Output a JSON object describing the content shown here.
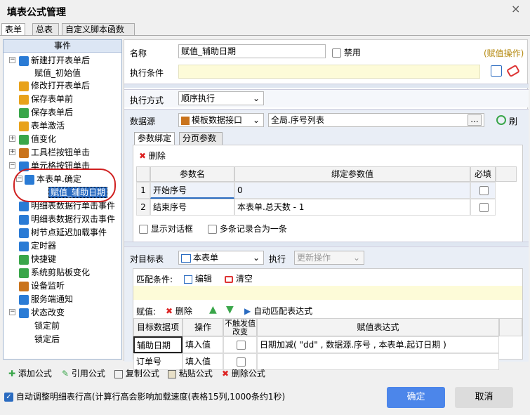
{
  "window": {
    "title": "填表公式管理",
    "close": "×"
  },
  "tabs": [
    "表单",
    "总表",
    "自定义脚本函数"
  ],
  "left": {
    "header": "事件",
    "items": [
      {
        "label": "新建打开表单后",
        "icon": "person-icon",
        "color": "#2a7bd5"
      },
      {
        "label": "赋值_初始值",
        "icon": "",
        "color": ""
      },
      {
        "label": "修改打开表单后",
        "icon": "folder-icon",
        "color": "#e8a21b"
      },
      {
        "label": "保存表单前",
        "icon": "folder-icon",
        "color": "#e8a21b"
      },
      {
        "label": "保存表单后",
        "icon": "folder-icon",
        "color": "#3aa64a"
      },
      {
        "label": "表单激活",
        "icon": "folder-icon",
        "color": "#e8a21b"
      },
      {
        "label": "值变化",
        "icon": "123-icon",
        "color": "#3aa64a"
      },
      {
        "label": "工具栏按钮单击",
        "icon": "tools-icon",
        "color": "#c9731c"
      },
      {
        "label": "单元格按钮单击",
        "icon": "dots-icon",
        "color": "#2a7bd5"
      },
      {
        "label": "本表单.确定",
        "icon": "layers-icon",
        "color": "#2a7bd5"
      },
      {
        "label": "赋值_辅助日期",
        "icon": "",
        "color": ""
      },
      {
        "label": "明细表数据行单击事件",
        "icon": "gear-icon",
        "color": "#2a7bd5"
      },
      {
        "label": "明细表数据行双击事件",
        "icon": "gear-icon",
        "color": "#2a7bd5"
      },
      {
        "label": "树节点延迟加载事件",
        "icon": "gear-icon",
        "color": "#2a7bd5"
      },
      {
        "label": "定时器",
        "icon": "clock-icon",
        "color": "#2a7bd5"
      },
      {
        "label": "快捷键",
        "icon": "share-icon",
        "color": "#3aa64a"
      },
      {
        "label": "系统剪贴板变化",
        "icon": "scissors-icon",
        "color": "#3aa64a"
      },
      {
        "label": "设备监听",
        "icon": "device-icon",
        "color": "#c9731c"
      },
      {
        "label": "服务端通知",
        "icon": "bell-icon",
        "color": "#2a7bd5"
      },
      {
        "label": "状态改变",
        "icon": "t-icon",
        "color": "#2a7bd5"
      },
      {
        "label": "锁定前",
        "icon": "",
        "color": ""
      },
      {
        "label": "锁定后",
        "icon": "",
        "color": ""
      }
    ]
  },
  "form": {
    "name_label": "名称",
    "name_value": "赋值_辅助日期",
    "disable_label": "禁用",
    "op_tag": "(赋值操作)",
    "cond_label": "执行条件",
    "exec_label": "执行方式",
    "exec_value": "顺序执行"
  },
  "datasource": {
    "label": "数据源",
    "type_value": "模板数据接口",
    "source_value": "全局.序号列表",
    "more": "...",
    "refresh_cut": "刷",
    "tabs": [
      "参数绑定",
      "分页参数"
    ],
    "delete_label": "删除",
    "cols": [
      "参数名",
      "绑定参数值",
      "必填"
    ],
    "rows": [
      {
        "idx": "1",
        "name": "开始序号",
        "value": "0"
      },
      {
        "idx": "2",
        "name": "结束序号",
        "value": "本表单.总天数 - 1"
      }
    ],
    "show_dialog": "显示对话框",
    "merge_label": "多条记录合为一条"
  },
  "target": {
    "label": "对目标表",
    "table_value": "本表单",
    "exec_label": "执行",
    "exec_value": "更新操作",
    "match_label": "匹配条件:",
    "edit_label": "编辑",
    "clear_label": "清空",
    "assign_label": "赋值:",
    "delete_label": "删除",
    "auto_label": "自动匹配表达式",
    "cols": [
      "目标数据项",
      "操作",
      "不触发值改变",
      "赋值表达式"
    ],
    "rows": [
      {
        "field": "辅助日期",
        "op": "填入值",
        "expr": "日期加减( \"dd\" , 数据源.序号 , 本表单.起订日期 )"
      },
      {
        "field": "订单号",
        "op": "填入值",
        "expr": ""
      }
    ]
  },
  "toolbar": {
    "add": "添加公式",
    "ref": "引用公式",
    "copy": "复制公式",
    "paste": "粘贴公式",
    "del": "删除公式"
  },
  "footer": {
    "auto_row": "自动调整明细表行高(计算行高会影响加载速度(表格15列,1000条约1秒)",
    "ok": "确定",
    "cancel": "取消"
  }
}
